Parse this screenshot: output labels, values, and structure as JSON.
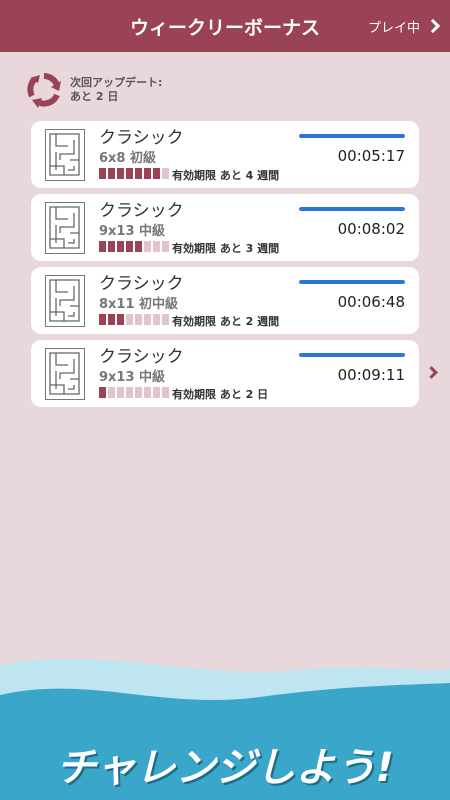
{
  "header": {
    "title": "ウィークリーボーナス",
    "right_label": "プレイ中"
  },
  "update": {
    "line1": "次回アップデート:",
    "line2": "あと 2 日"
  },
  "cards": [
    {
      "title": "クラシック",
      "sub": "6x8 初級",
      "level": 7,
      "level_max": 8,
      "expiry": "有効期限 あと 4 週間",
      "progress": 1.0,
      "time": "00:05:17"
    },
    {
      "title": "クラシック",
      "sub": "9x13 中級",
      "level": 5,
      "level_max": 8,
      "expiry": "有効期限 あと 3 週間",
      "progress": 1.0,
      "time": "00:08:02"
    },
    {
      "title": "クラシック",
      "sub": "8x11 初中級",
      "level": 3,
      "level_max": 8,
      "expiry": "有効期限 あと 2 週間",
      "progress": 1.0,
      "time": "00:06:48"
    },
    {
      "title": "クラシック",
      "sub": "9x13 中級",
      "level": 1,
      "level_max": 8,
      "expiry": "有効期限 あと 2 日",
      "progress": 1.0,
      "time": "00:09:11"
    }
  ],
  "footer": {
    "text": "チャレンジしよう!"
  },
  "colors": {
    "accent": "#9a4256",
    "progress": "#2a76d2",
    "background": "#e8d7db",
    "wave": "#3aa6c9"
  }
}
